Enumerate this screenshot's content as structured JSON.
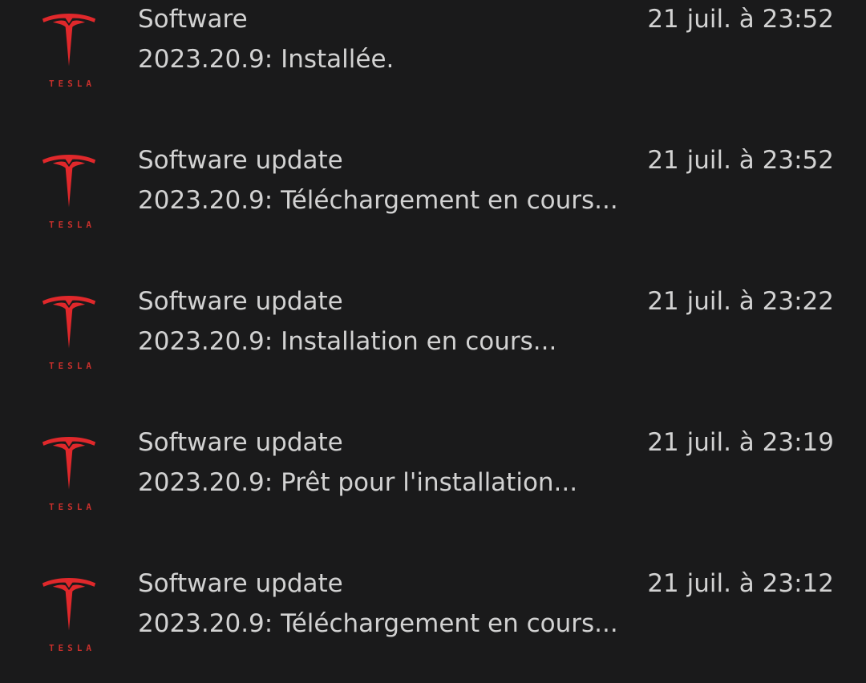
{
  "brand": {
    "wordmark": "TESLA",
    "color": "#e0282b"
  },
  "notifications": [
    {
      "title": "Software",
      "time": "21 juil. à 23:52",
      "message": "2023.20.9: Installée."
    },
    {
      "title": "Software update",
      "time": "21 juil. à 23:52",
      "message": "2023.20.9: Téléchargement en cours..."
    },
    {
      "title": "Software update",
      "time": "21 juil. à 23:22",
      "message": "2023.20.9: Installation en cours..."
    },
    {
      "title": "Software update",
      "time": "21 juil. à 23:19",
      "message": "2023.20.9: Prêt pour l'installation..."
    },
    {
      "title": "Software update",
      "time": "21 juil. à 23:12",
      "message": "2023.20.9: Téléchargement en cours..."
    }
  ]
}
